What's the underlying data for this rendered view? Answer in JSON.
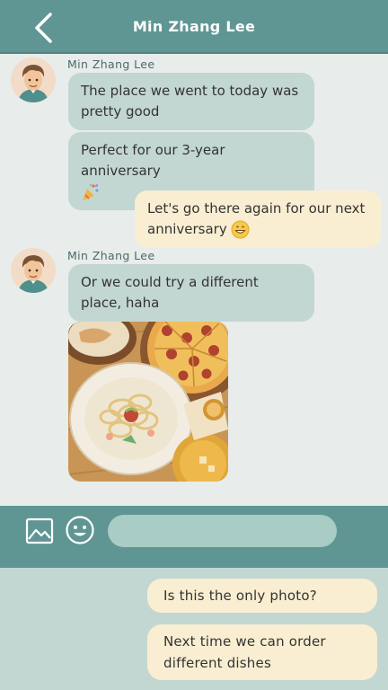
{
  "header": {
    "title": "Min Zhang Lee",
    "back_icon": "chevron-left-icon"
  },
  "colors": {
    "accent": "#5f9693",
    "incoming_bubble": "#c3d7d2",
    "outgoing_bubble": "#f9eed2",
    "chat_background": "#e8eceb",
    "input_background": "#a9ccc5"
  },
  "messages": [
    {
      "sender": "Min Zhang Lee",
      "text": "The place we went to today was pretty good",
      "direction": "in"
    },
    {
      "text": "Perfect for our 3-year anniversary",
      "direction": "in",
      "emoji": "party-popper-icon"
    },
    {
      "text": "Let's go there again for our next anniversary",
      "direction": "out",
      "emoji": "grinning-face-icon"
    },
    {
      "sender": "Min Zhang Lee",
      "text": "Or we could try a different place, haha",
      "direction": "in"
    },
    {
      "type": "photo",
      "direction": "in",
      "description_icon": "food-photo"
    }
  ],
  "composer": {
    "image_icon": "image-icon",
    "emoji_icon": "smiley-icon",
    "input_value": "",
    "input_placeholder": ""
  },
  "suggestions": [
    "Is this the only photo?",
    "Next time we can order different dishes"
  ]
}
